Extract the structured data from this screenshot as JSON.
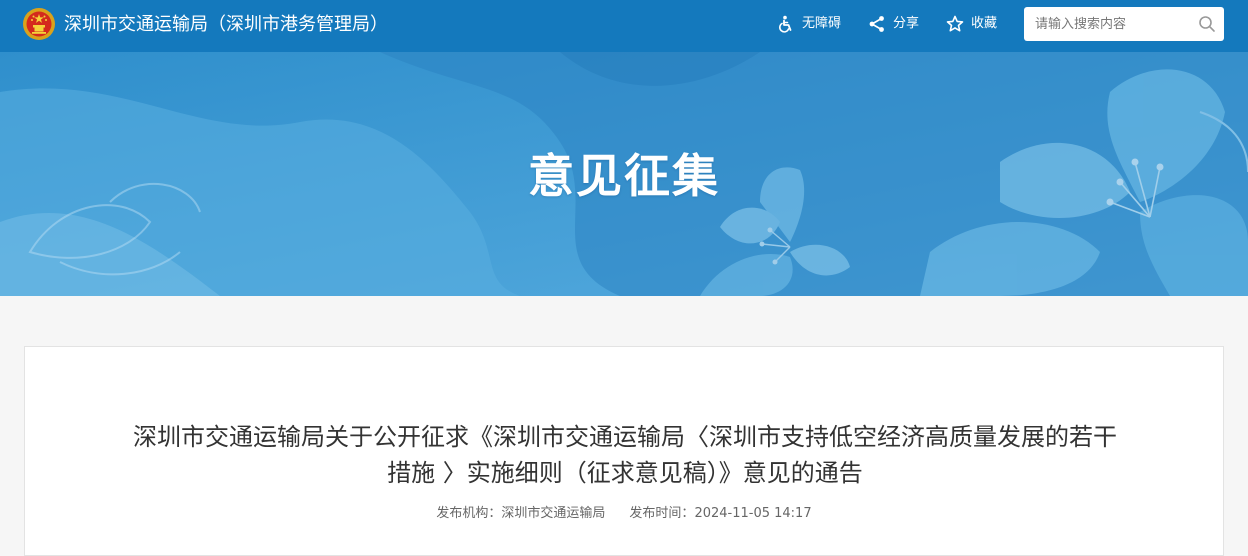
{
  "header": {
    "site_title": "深圳市交通运输局（深圳市港务管理局）",
    "emblem_icon": "national-emblem-icon",
    "tools": {
      "accessibility": {
        "label": "无障碍",
        "icon": "accessibility-icon"
      },
      "share": {
        "label": "分享",
        "icon": "share-icon"
      },
      "favorite": {
        "label": "收藏",
        "icon": "star-icon"
      }
    },
    "search": {
      "placeholder": "请输入搜索内容",
      "icon": "search-icon"
    }
  },
  "banner": {
    "title": "意见征集"
  },
  "article": {
    "title": "深圳市交通运输局关于公开征求《深圳市交通运输局〈深圳市支持低空经济高质量发展的若干措施 〉实施细则（征求意见稿）》意见的通告",
    "publisher_label": "发布机构：",
    "publisher": "深圳市交通运输局",
    "time_label": "发布时间：",
    "time": "2024-11-05 14:17"
  },
  "colors": {
    "topbar": "#1479bd",
    "banner": "#3d97d2",
    "page_bg": "#f6f6f6"
  }
}
